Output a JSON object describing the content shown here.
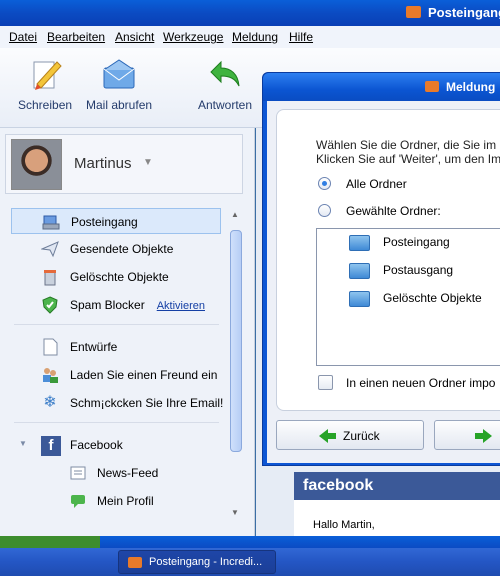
{
  "window": {
    "title": "Posteingang"
  },
  "menu": [
    "Datei",
    "Bearbeiten",
    "Ansicht",
    "Werkzeuge",
    "Meldung",
    "Hilfe"
  ],
  "toolbar": {
    "write": "Schreiben",
    "fetch": "Mail abrufen",
    "reply": "Antworten"
  },
  "profile": {
    "name": "Martinus"
  },
  "folders": {
    "inbox": "Posteingang",
    "sent": "Gesendete Objekte",
    "deleted": "Gelöschte Objekte",
    "spam": "Spam Blocker",
    "spam_link": "Aktivieren",
    "drafts": "Entwürfe",
    "invite": "Laden Sie einen Freund ein",
    "decorate": "Schm¡ckcken Sie Ihre Email!",
    "facebook": "Facebook",
    "newsfeed": "News-Feed",
    "myprofile": "Mein Profil"
  },
  "dialog": {
    "title": "Meldung",
    "instr1": "Wählen Sie die Ordner, die Sie im",
    "instr2": "Klicken Sie auf  'Weiter', um den Im",
    "radio_all": "Alle Ordner",
    "radio_selected": "Gewählte Ordner:",
    "radio_all_checked": true,
    "list": [
      "Posteingang",
      "Postausgang",
      "Gelöschte Objekte"
    ],
    "checkbox_label": "In einen neuen Ordner impo",
    "back": "Zurück"
  },
  "preview": {
    "brand": "facebook",
    "greeting": "Hallo Martin,"
  },
  "taskbar": {
    "item": "Posteingang - Incredi..."
  }
}
